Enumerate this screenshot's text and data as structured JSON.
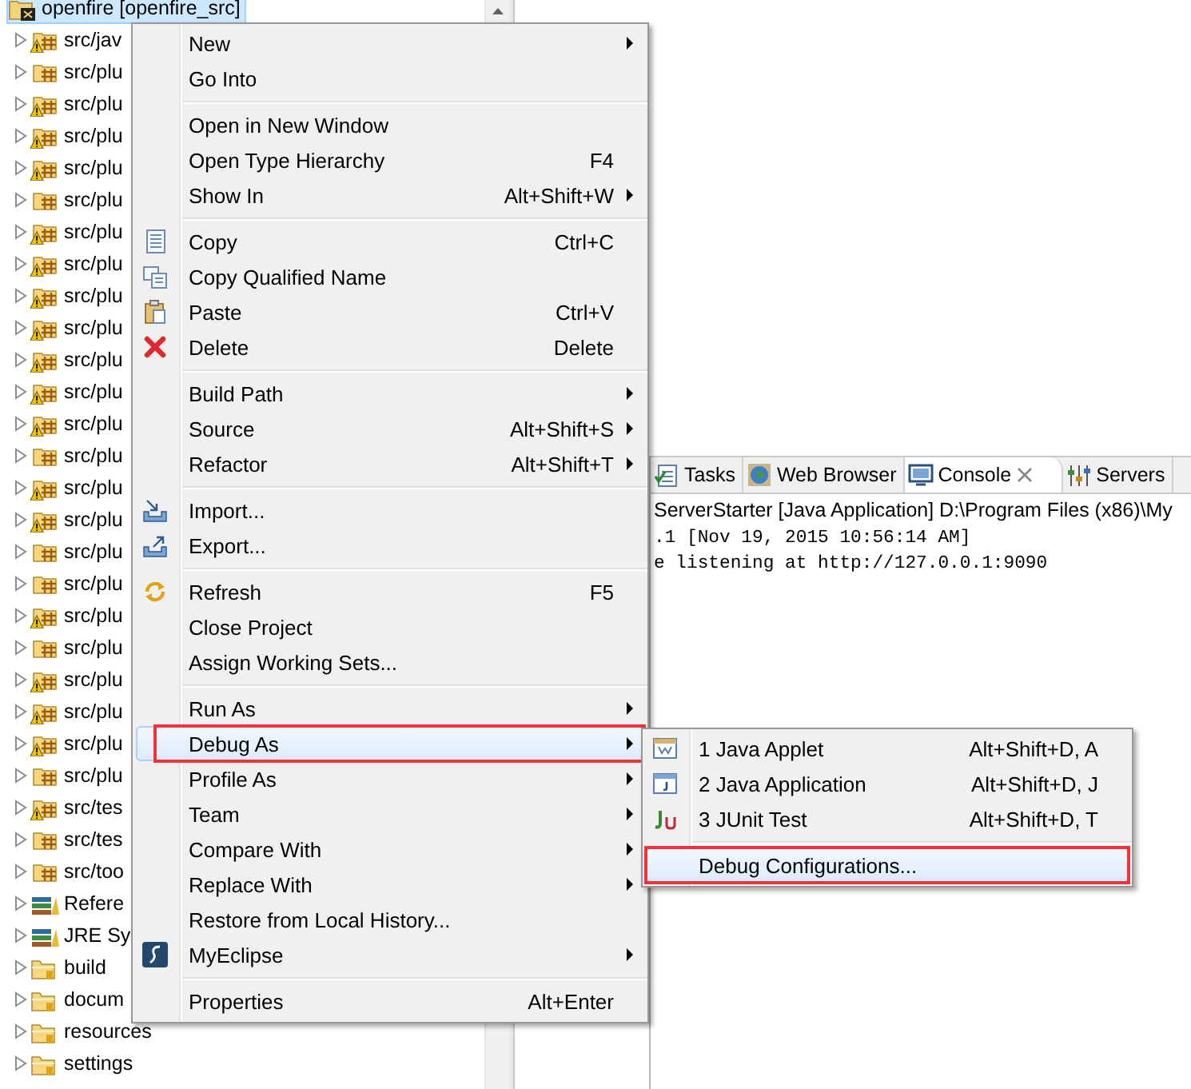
{
  "tree": {
    "items": [
      {
        "label": "openfire [openfire_src]",
        "kind": "project",
        "warning": false,
        "selected": true
      },
      {
        "label": "src/jav",
        "kind": "package",
        "warning": true,
        "selected": false
      },
      {
        "label": "src/plu",
        "kind": "package",
        "warning": false,
        "selected": false
      },
      {
        "label": "src/plu",
        "kind": "package",
        "warning": true,
        "selected": false
      },
      {
        "label": "src/plu",
        "kind": "package",
        "warning": true,
        "selected": false
      },
      {
        "label": "src/plu",
        "kind": "package",
        "warning": true,
        "selected": false
      },
      {
        "label": "src/plu",
        "kind": "package",
        "warning": false,
        "selected": false
      },
      {
        "label": "src/plu",
        "kind": "package",
        "warning": true,
        "selected": false
      },
      {
        "label": "src/plu",
        "kind": "package",
        "warning": true,
        "selected": false
      },
      {
        "label": "src/plu",
        "kind": "package",
        "warning": true,
        "selected": false
      },
      {
        "label": "src/plu",
        "kind": "package",
        "warning": true,
        "selected": false
      },
      {
        "label": "src/plu",
        "kind": "package",
        "warning": true,
        "selected": false
      },
      {
        "label": "src/plu",
        "kind": "package",
        "warning": true,
        "selected": false
      },
      {
        "label": "src/plu",
        "kind": "package",
        "warning": true,
        "selected": false
      },
      {
        "label": "src/plu",
        "kind": "package",
        "warning": false,
        "selected": false
      },
      {
        "label": "src/plu",
        "kind": "package",
        "warning": true,
        "selected": false
      },
      {
        "label": "src/plu",
        "kind": "package",
        "warning": true,
        "selected": false
      },
      {
        "label": "src/plu",
        "kind": "package",
        "warning": false,
        "selected": false
      },
      {
        "label": "src/plu",
        "kind": "package",
        "warning": false,
        "selected": false
      },
      {
        "label": "src/plu",
        "kind": "package",
        "warning": true,
        "selected": false
      },
      {
        "label": "src/plu",
        "kind": "package",
        "warning": false,
        "selected": false
      },
      {
        "label": "src/plu",
        "kind": "package",
        "warning": true,
        "selected": false
      },
      {
        "label": "src/plu",
        "kind": "package",
        "warning": true,
        "selected": false
      },
      {
        "label": "src/plu",
        "kind": "package",
        "warning": true,
        "selected": false
      },
      {
        "label": "src/plu",
        "kind": "package",
        "warning": false,
        "selected": false
      },
      {
        "label": "src/tes",
        "kind": "package",
        "warning": true,
        "selected": false
      },
      {
        "label": "src/tes",
        "kind": "package",
        "warning": false,
        "selected": false
      },
      {
        "label": "src/too",
        "kind": "package",
        "warning": false,
        "selected": false
      },
      {
        "label": "Refere",
        "kind": "library",
        "warning": false,
        "selected": false
      },
      {
        "label": "JRE Sy",
        "kind": "library",
        "warning": false,
        "selected": false
      },
      {
        "label": "build",
        "kind": "folder",
        "warning": false,
        "selected": false
      },
      {
        "label": "docum",
        "kind": "folder",
        "warning": false,
        "selected": false
      },
      {
        "label": "resources",
        "kind": "folder",
        "warning": false,
        "selected": false
      },
      {
        "label": "settings",
        "kind": "folder",
        "warning": false,
        "selected": false
      }
    ]
  },
  "console": {
    "tabs": [
      {
        "label": "Tasks",
        "kind": "tasks",
        "selected": false,
        "closable": false
      },
      {
        "label": "Web Browser",
        "kind": "browser",
        "selected": false,
        "closable": false
      },
      {
        "label": "Console",
        "kind": "console",
        "selected": true,
        "closable": true
      },
      {
        "label": "Servers",
        "kind": "servers",
        "selected": false,
        "closable": false
      }
    ],
    "launch": "ServerStarter [Java Application] D:\\Program Files (x86)\\My",
    "lines": [
      ".1 [Nov 19, 2015 10:56:14 AM]",
      "e listening at http://127.0.0.1:9090"
    ]
  },
  "context_menu": {
    "groups": [
      [
        {
          "label": "New",
          "kind": "plain",
          "submenu": true,
          "selected": false,
          "annotated": false
        },
        {
          "label": "Go Into",
          "kind": "plain",
          "submenu": false,
          "selected": false,
          "annotated": false
        }
      ],
      [
        {
          "label": "Open in New Window",
          "kind": "plain",
          "submenu": false,
          "selected": false,
          "annotated": false
        },
        {
          "label": "Open Type Hierarchy",
          "shortcut": "F4",
          "kind": "plain",
          "submenu": false,
          "selected": false,
          "annotated": false
        },
        {
          "label": "Show In",
          "shortcut": "Alt+Shift+W",
          "kind": "plain",
          "submenu": true,
          "selected": false,
          "annotated": false
        }
      ],
      [
        {
          "label": "Copy",
          "shortcut": "Ctrl+C",
          "kind": "copy",
          "submenu": false,
          "selected": false,
          "annotated": false
        },
        {
          "label": "Copy Qualified Name",
          "kind": "copy-name",
          "submenu": false,
          "selected": false,
          "annotated": false
        },
        {
          "label": "Paste",
          "shortcut": "Ctrl+V",
          "kind": "paste",
          "submenu": false,
          "selected": false,
          "annotated": false
        },
        {
          "label": "Delete",
          "shortcut": "Delete",
          "kind": "delete",
          "submenu": false,
          "selected": false,
          "annotated": false
        }
      ],
      [
        {
          "label": "Build Path",
          "kind": "plain",
          "submenu": true,
          "selected": false,
          "annotated": false
        },
        {
          "label": "Source",
          "shortcut": "Alt+Shift+S",
          "kind": "plain",
          "submenu": true,
          "selected": false,
          "annotated": false
        },
        {
          "label": "Refactor",
          "shortcut": "Alt+Shift+T",
          "kind": "plain",
          "submenu": true,
          "selected": false,
          "annotated": false
        }
      ],
      [
        {
          "label": "Import...",
          "kind": "import",
          "submenu": false,
          "selected": false,
          "annotated": false
        },
        {
          "label": "Export...",
          "kind": "export",
          "submenu": false,
          "selected": false,
          "annotated": false
        }
      ],
      [
        {
          "label": "Refresh",
          "shortcut": "F5",
          "kind": "refresh",
          "submenu": false,
          "selected": false,
          "annotated": false
        },
        {
          "label": "Close Project",
          "kind": "plain",
          "submenu": false,
          "selected": false,
          "annotated": false
        },
        {
          "label": "Assign Working Sets...",
          "kind": "plain",
          "submenu": false,
          "selected": false,
          "annotated": false
        }
      ],
      [
        {
          "label": "Run As",
          "kind": "plain",
          "submenu": true,
          "selected": false,
          "annotated": false
        },
        {
          "label": "Debug As",
          "kind": "plain",
          "submenu": true,
          "selected": true,
          "annotated": true
        },
        {
          "label": "Profile As",
          "kind": "plain",
          "submenu": true,
          "selected": false,
          "annotated": false
        },
        {
          "label": "Team",
          "kind": "plain",
          "submenu": true,
          "selected": false,
          "annotated": false
        },
        {
          "label": "Compare With",
          "kind": "plain",
          "submenu": true,
          "selected": false,
          "annotated": false
        },
        {
          "label": "Replace With",
          "kind": "plain",
          "submenu": true,
          "selected": false,
          "annotated": false
        },
        {
          "label": "Restore from Local History...",
          "kind": "plain",
          "submenu": false,
          "selected": false,
          "annotated": false
        },
        {
          "label": "MyEclipse",
          "kind": "myeclipse",
          "submenu": true,
          "selected": false,
          "annotated": false
        }
      ],
      [
        {
          "label": "Properties",
          "shortcut": "Alt+Enter",
          "kind": "plain",
          "submenu": false,
          "selected": false,
          "annotated": false
        }
      ]
    ]
  },
  "submenu": {
    "groups": [
      [
        {
          "label": "1 Java Applet",
          "shortcut": "Alt+Shift+D, A",
          "kind": "applet",
          "submenu": false,
          "selected": false,
          "annotated": false
        },
        {
          "label": "2 Java Application",
          "shortcut": "Alt+Shift+D, J",
          "kind": "application",
          "submenu": false,
          "selected": false,
          "annotated": false
        },
        {
          "label": "3 JUnit Test",
          "shortcut": "Alt+Shift+D, T",
          "kind": "junit",
          "submenu": false,
          "selected": false,
          "annotated": false
        }
      ],
      [
        {
          "label": "Debug Configurations...",
          "kind": "plain",
          "submenu": false,
          "selected": true,
          "annotated": true
        }
      ]
    ]
  }
}
